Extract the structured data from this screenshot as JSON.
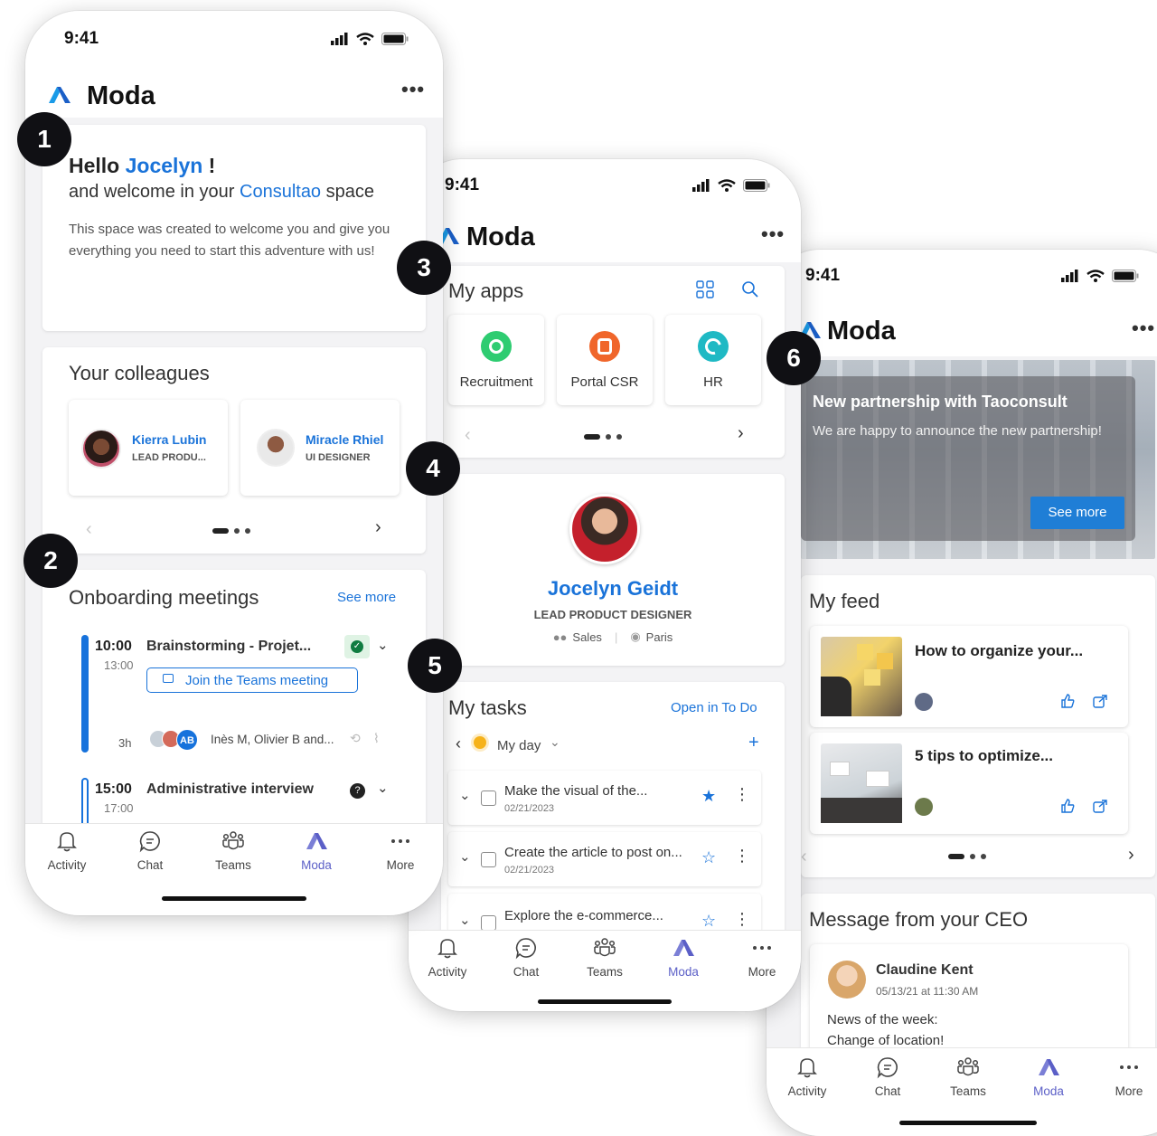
{
  "status_time": "9:41",
  "app_title": "Moda",
  "colors": {
    "accent": "#1a73d9",
    "brand_purple": "#5b5fc7",
    "badge": "#101014",
    "meeting_bar": "#1672dc"
  },
  "badges": [
    "1",
    "2",
    "3",
    "4",
    "5",
    "6"
  ],
  "tabs": [
    "Activity",
    "Chat",
    "Teams",
    "Moda",
    "More"
  ],
  "phone1": {
    "welcome": {
      "hello": "Hello",
      "name": "Jocelyn",
      "exclaim": "!",
      "line2_prefix": "and welcome in your",
      "space_name": "Consultao",
      "line2_suffix": "space",
      "body": "This space was created to welcome you and give you everything you need to start this adventure with us!"
    },
    "colleagues": {
      "title": "Your colleagues",
      "people": [
        {
          "name": "Kierra Lubin",
          "role": "LEAD PRODU..."
        },
        {
          "name": "Miracle Rhiel",
          "role": "UI DESIGNER"
        }
      ]
    },
    "meetings": {
      "title": "Onboarding meetings",
      "see_more": "See more",
      "items": [
        {
          "start": "10:00",
          "end": "13:00",
          "title": "Brainstorming - Projet...",
          "join": "Join the Teams meeting",
          "duration": "3h",
          "attendees_initials": "AB",
          "attendees": "Inès M, Olivier B and..."
        },
        {
          "start": "15:00",
          "end": "17:00",
          "title": "Administrative interview"
        }
      ]
    }
  },
  "phone2": {
    "apps": {
      "title": "My apps",
      "items": [
        {
          "label": "Recruitment",
          "color": "#2ecc71"
        },
        {
          "label": "Portal CSR",
          "color": "#f0662b"
        },
        {
          "label": "HR",
          "color": "#1fb9c4"
        }
      ]
    },
    "profile": {
      "name": "Jocelyn Geidt",
      "role": "LEAD PRODUCT DESIGNER",
      "department": "Sales",
      "location": "Paris"
    },
    "tasks": {
      "title": "My tasks",
      "open_link": "Open in To Do",
      "filter": "My day",
      "items": [
        {
          "title": "Make the visual of the...",
          "date": "02/21/2023",
          "starred": true
        },
        {
          "title": "Create the article to post on...",
          "date": "02/21/2023",
          "starred": false
        },
        {
          "title": "Explore the e-commerce...",
          "date": "",
          "starred": false
        }
      ]
    }
  },
  "phone3": {
    "news": {
      "title": "New partnership with Taoconsult",
      "body": "We are happy to announce the new partnership!",
      "button": "See more"
    },
    "feed": {
      "title": "My feed",
      "items": [
        {
          "title": "How to organize your..."
        },
        {
          "title": "5 tips to optimize..."
        }
      ]
    },
    "ceo": {
      "title": "Message from your CEO",
      "name": "Claudine Kent",
      "date": "05/13/21 at 11:30 AM",
      "line1": "News of the week:",
      "line2": "Change of location!"
    }
  }
}
